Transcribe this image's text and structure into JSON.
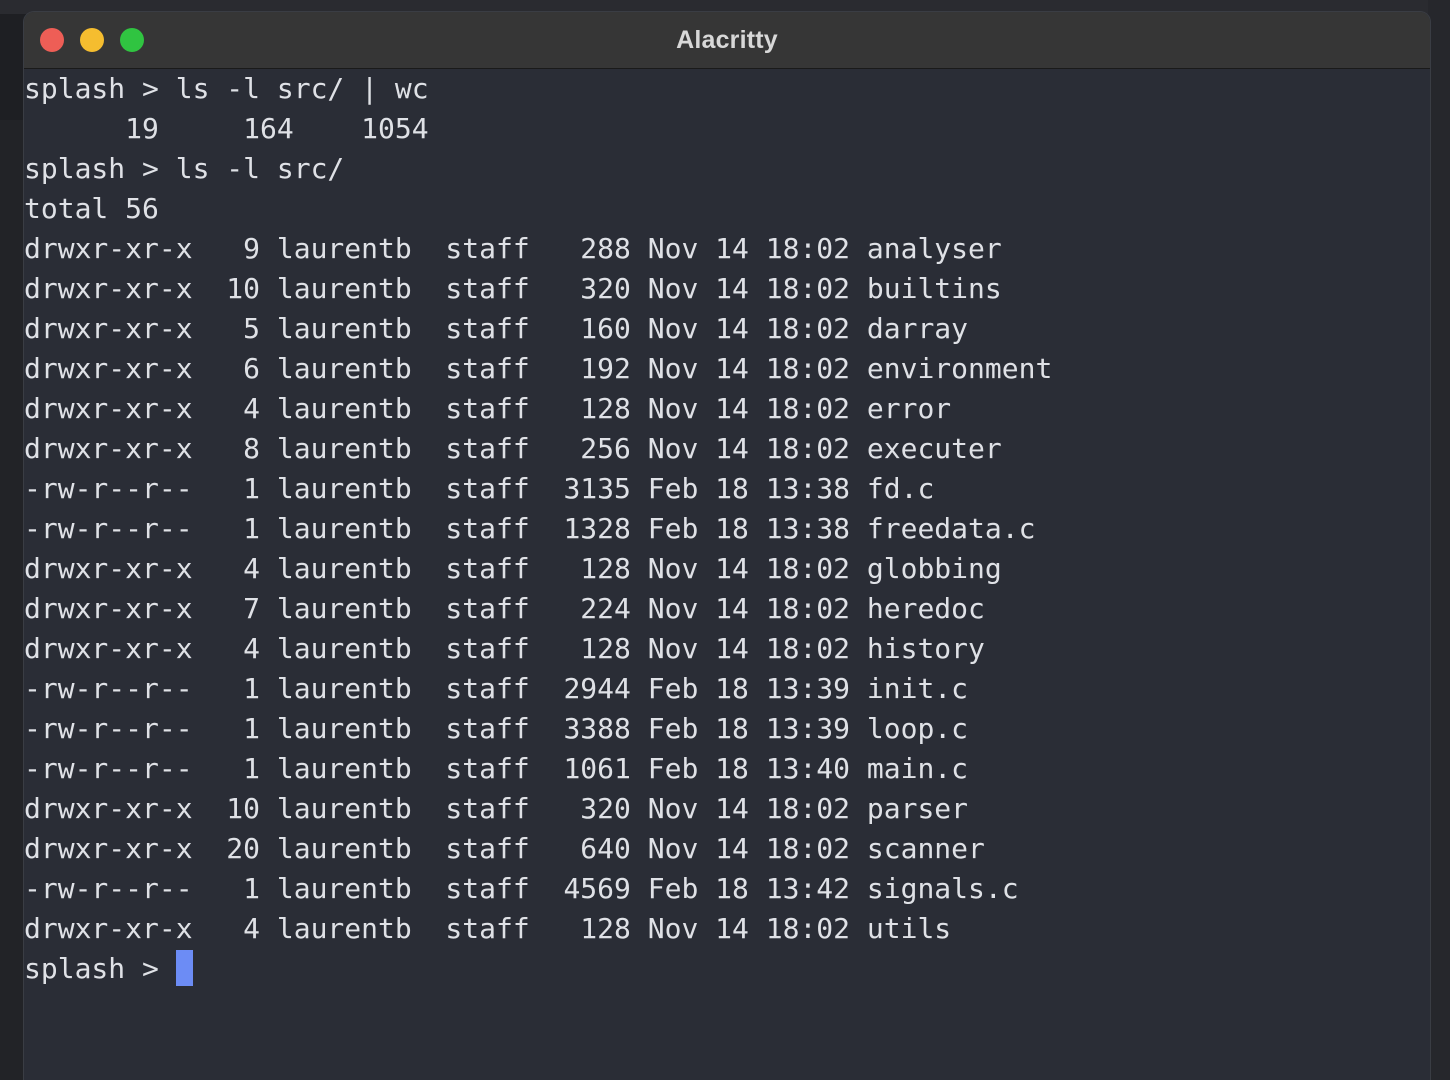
{
  "window": {
    "title": "Alacritty"
  },
  "terminal": {
    "lines": [
      "splash > ls -l src/ | wc",
      "      19     164    1054",
      "splash > ls -l src/",
      "total 56",
      "drwxr-xr-x   9 laurentb  staff   288 Nov 14 18:02 analyser",
      "drwxr-xr-x  10 laurentb  staff   320 Nov 14 18:02 builtins",
      "drwxr-xr-x   5 laurentb  staff   160 Nov 14 18:02 darray",
      "drwxr-xr-x   6 laurentb  staff   192 Nov 14 18:02 environment",
      "drwxr-xr-x   4 laurentb  staff   128 Nov 14 18:02 error",
      "drwxr-xr-x   8 laurentb  staff   256 Nov 14 18:02 executer",
      "-rw-r--r--   1 laurentb  staff  3135 Feb 18 13:38 fd.c",
      "-rw-r--r--   1 laurentb  staff  1328 Feb 18 13:38 freedata.c",
      "drwxr-xr-x   4 laurentb  staff   128 Nov 14 18:02 globbing",
      "drwxr-xr-x   7 laurentb  staff   224 Nov 14 18:02 heredoc",
      "drwxr-xr-x   4 laurentb  staff   128 Nov 14 18:02 history",
      "-rw-r--r--   1 laurentb  staff  2944 Feb 18 13:39 init.c",
      "-rw-r--r--   1 laurentb  staff  3388 Feb 18 13:39 loop.c",
      "-rw-r--r--   1 laurentb  staff  1061 Feb 18 13:40 main.c",
      "drwxr-xr-x  10 laurentb  staff   320 Nov 14 18:02 parser",
      "drwxr-xr-x  20 laurentb  staff   640 Nov 14 18:02 scanner",
      "-rw-r--r--   1 laurentb  staff  4569 Feb 18 13:42 signals.c",
      "drwxr-xr-x   4 laurentb  staff   128 Nov 14 18:02 utils"
    ],
    "prompt": "splash > "
  },
  "colors": {
    "background": "#2a2d36",
    "foreground": "#dfe1e6",
    "cursor": "#6c8cf5",
    "titlebar": "#363636",
    "close": "#ee5e56",
    "minimize": "#f5bd2f",
    "zoom": "#30c441"
  }
}
